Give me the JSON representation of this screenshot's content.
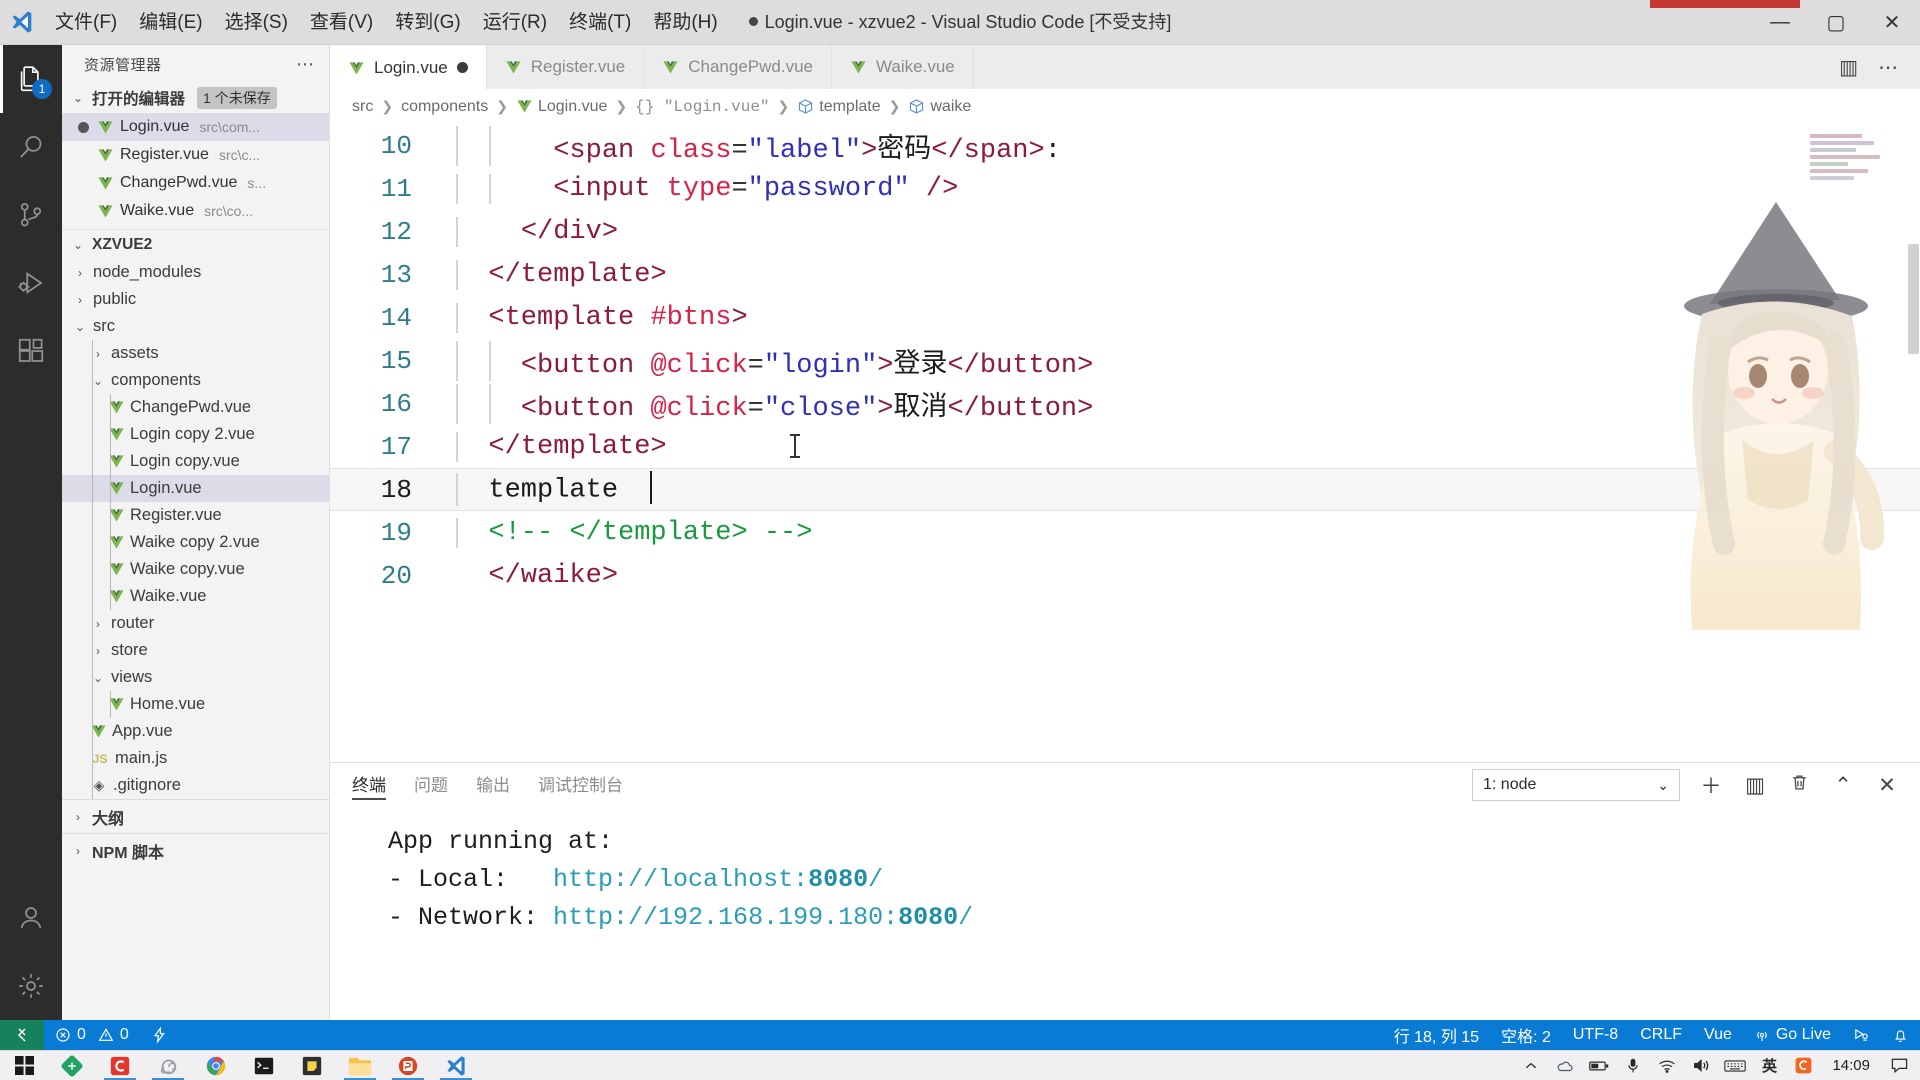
{
  "titlebar": {
    "menus": [
      "文件(F)",
      "编辑(E)",
      "选择(S)",
      "查看(V)",
      "转到(G)",
      "运行(R)",
      "终端(T)",
      "帮助(H)"
    ],
    "window_title": "Login.vue - xzvue2 - Visual Studio Code [不受支持]",
    "minimize": "—",
    "maximize": "▢",
    "close": "✕"
  },
  "activitybar": {
    "items": [
      {
        "name": "explorer",
        "icon": "files-icon",
        "badge": "1",
        "active": true
      },
      {
        "name": "search",
        "icon": "search-icon",
        "badge": "",
        "active": false
      },
      {
        "name": "source-control",
        "icon": "source-control-icon",
        "badge": "",
        "active": false
      },
      {
        "name": "run-and-debug",
        "icon": "run-debug-icon",
        "badge": "",
        "active": false
      },
      {
        "name": "extensions",
        "icon": "extensions-icon",
        "badge": "",
        "active": false
      }
    ],
    "bottom": [
      {
        "name": "accounts",
        "icon": "account-icon"
      },
      {
        "name": "settings",
        "icon": "gear-icon"
      }
    ]
  },
  "sidebar": {
    "title": "资源管理器",
    "more_actions": "⋯",
    "open_editors": {
      "label": "打开的编辑器",
      "badge": "1 个未保存",
      "chevron": "⌄",
      "items": [
        {
          "name": "Login.vue",
          "path": "src\\com...",
          "dirty": true,
          "selected": true
        },
        {
          "name": "Register.vue",
          "path": "src\\c...",
          "dirty": false,
          "selected": false
        },
        {
          "name": "ChangePwd.vue",
          "path": "s...",
          "dirty": false,
          "selected": false
        },
        {
          "name": "Waike.vue",
          "path": "src\\co...",
          "dirty": false,
          "selected": false
        }
      ]
    },
    "project": {
      "label": "XZVUE2",
      "chevron": "⌄",
      "tree": [
        {
          "label": "node_modules",
          "kind": "folder",
          "expanded": false,
          "depth": 1
        },
        {
          "label": "public",
          "kind": "folder",
          "expanded": false,
          "depth": 1
        },
        {
          "label": "src",
          "kind": "folder",
          "expanded": true,
          "depth": 1
        },
        {
          "label": "assets",
          "kind": "folder",
          "expanded": false,
          "depth": 2
        },
        {
          "label": "components",
          "kind": "folder",
          "expanded": true,
          "depth": 2
        },
        {
          "label": "ChangePwd.vue",
          "kind": "vue",
          "depth": 3
        },
        {
          "label": "Login copy 2.vue",
          "kind": "vue",
          "depth": 3
        },
        {
          "label": "Login copy.vue",
          "kind": "vue",
          "depth": 3
        },
        {
          "label": "Login.vue",
          "kind": "vue",
          "depth": 3,
          "selected": true
        },
        {
          "label": "Register.vue",
          "kind": "vue",
          "depth": 3
        },
        {
          "label": "Waike copy 2.vue",
          "kind": "vue",
          "depth": 3
        },
        {
          "label": "Waike copy.vue",
          "kind": "vue",
          "depth": 3
        },
        {
          "label": "Waike.vue",
          "kind": "vue",
          "depth": 3
        },
        {
          "label": "router",
          "kind": "folder",
          "expanded": false,
          "depth": 2
        },
        {
          "label": "store",
          "kind": "folder",
          "expanded": false,
          "depth": 2
        },
        {
          "label": "views",
          "kind": "folder",
          "expanded": true,
          "depth": 2
        },
        {
          "label": "Home.vue",
          "kind": "vue",
          "depth": 3
        },
        {
          "label": "App.vue",
          "kind": "vue",
          "depth": 2
        },
        {
          "label": "main.js",
          "kind": "js",
          "depth": 2
        },
        {
          "label": ".gitignore",
          "kind": "git",
          "depth": 2
        }
      ]
    },
    "sections": [
      {
        "label": "大纲",
        "chevron": "›"
      },
      {
        "label": "NPM 脚本",
        "chevron": "›"
      }
    ]
  },
  "editor": {
    "tabs": [
      {
        "label": "Login.vue",
        "active": true,
        "dirty": true
      },
      {
        "label": "Register.vue",
        "active": false,
        "dirty": false
      },
      {
        "label": "ChangePwd.vue",
        "active": false,
        "dirty": false
      },
      {
        "label": "Waike.vue",
        "active": false,
        "dirty": false
      }
    ],
    "tab_actions": [
      {
        "name": "split-editor-icon",
        "glyph": "▥"
      },
      {
        "name": "more-actions-icon",
        "glyph": "⋯"
      }
    ],
    "breadcrumb": [
      "src",
      "components",
      "Login.vue",
      "{} \"Login.vue\"",
      "template",
      "waike"
    ],
    "lines": [
      {
        "num": "10",
        "indent_guides": 2,
        "tokens": [
          {
            "t": "      ",
            "c": "plain"
          },
          {
            "t": "<span ",
            "c": "tag"
          },
          {
            "t": "class",
            "c": "attr"
          },
          {
            "t": "=",
            "c": "eq"
          },
          {
            "t": "\"label\"",
            "c": "str"
          },
          {
            "t": ">",
            "c": "tag"
          },
          {
            "t": "密码",
            "c": "text"
          },
          {
            "t": "</span>",
            "c": "tag"
          },
          {
            "t": ":",
            "c": "text"
          }
        ]
      },
      {
        "num": "11",
        "indent_guides": 2,
        "tokens": [
          {
            "t": "      ",
            "c": "plain"
          },
          {
            "t": "<input ",
            "c": "tag"
          },
          {
            "t": "type",
            "c": "attr"
          },
          {
            "t": "=",
            "c": "eq"
          },
          {
            "t": "\"password\"",
            "c": "str"
          },
          {
            "t": " />",
            "c": "tag"
          }
        ]
      },
      {
        "num": "12",
        "indent_guides": 1,
        "tokens": [
          {
            "t": "    ",
            "c": "plain"
          },
          {
            "t": "</div>",
            "c": "tag"
          }
        ]
      },
      {
        "num": "13",
        "indent_guides": 1,
        "tokens": [
          {
            "t": "  ",
            "c": "plain"
          },
          {
            "t": "</template>",
            "c": "tag"
          }
        ]
      },
      {
        "num": "14",
        "indent_guides": 1,
        "tokens": [
          {
            "t": "  ",
            "c": "plain"
          },
          {
            "t": "<template ",
            "c": "tag"
          },
          {
            "t": "#btns",
            "c": "attr"
          },
          {
            "t": ">",
            "c": "tag"
          }
        ]
      },
      {
        "num": "15",
        "indent_guides": 2,
        "tokens": [
          {
            "t": "    ",
            "c": "plain"
          },
          {
            "t": "<button ",
            "c": "tag"
          },
          {
            "t": "@click",
            "c": "attr"
          },
          {
            "t": "=",
            "c": "eq"
          },
          {
            "t": "\"login\"",
            "c": "str"
          },
          {
            "t": ">",
            "c": "tag"
          },
          {
            "t": "登录",
            "c": "text"
          },
          {
            "t": "</button>",
            "c": "tag"
          }
        ]
      },
      {
        "num": "16",
        "indent_guides": 2,
        "tokens": [
          {
            "t": "    ",
            "c": "plain"
          },
          {
            "t": "<button ",
            "c": "tag"
          },
          {
            "t": "@click",
            "c": "attr"
          },
          {
            "t": "=",
            "c": "eq"
          },
          {
            "t": "\"close\"",
            "c": "str"
          },
          {
            "t": ">",
            "c": "tag"
          },
          {
            "t": "取消",
            "c": "text"
          },
          {
            "t": "</button>",
            "c": "tag"
          }
        ]
      },
      {
        "num": "17",
        "indent_guides": 1,
        "tokens": [
          {
            "t": "  ",
            "c": "plain"
          },
          {
            "t": "</template>",
            "c": "tag"
          }
        ]
      },
      {
        "num": "18",
        "indent_guides": 1,
        "current": true,
        "caret_after": true,
        "tokens": [
          {
            "t": "  ",
            "c": "plain"
          },
          {
            "t": "template  ",
            "c": "text"
          }
        ]
      },
      {
        "num": "19",
        "indent_guides": 1,
        "tokens": [
          {
            "t": "  ",
            "c": "plain"
          },
          {
            "t": "<!-- </template> -->",
            "c": "comment"
          }
        ]
      },
      {
        "num": "20",
        "indent_guides": 0,
        "tokens": [
          {
            "t": "  ",
            "c": "plain"
          },
          {
            "t": "</waike>",
            "c": "tag"
          }
        ]
      }
    ]
  },
  "panel": {
    "tabs": [
      {
        "label": "终端",
        "active": true
      },
      {
        "label": "问题",
        "active": false
      },
      {
        "label": "输出",
        "active": false
      },
      {
        "label": "调试控制台",
        "active": false
      }
    ],
    "terminal_select": {
      "value": "1: node",
      "chevron": "⌄"
    },
    "actions": [
      {
        "name": "new-terminal-icon",
        "glyph": "＋"
      },
      {
        "name": "split-terminal-icon",
        "glyph": "▥"
      },
      {
        "name": "kill-terminal-icon",
        "glyph": "🗑"
      },
      {
        "name": "maximize-panel-icon",
        "glyph": "⌃"
      },
      {
        "name": "close-panel-icon",
        "glyph": "✕"
      }
    ],
    "terminal_lines": [
      {
        "text": "App running at:",
        "url": "",
        "port": ""
      },
      {
        "prefix": "- Local:   ",
        "url": "http://localhost:",
        "port": "8080",
        "suffix": "/"
      },
      {
        "prefix": "- Network: ",
        "url": "http://192.168.199.180:",
        "port": "8080",
        "suffix": "/"
      }
    ]
  },
  "statusbar": {
    "remote_icon": "remote-window-icon",
    "errors": "0",
    "warnings": "0",
    "ports_icon": "ports-icon",
    "right_items": [
      {
        "name": "cursor-position",
        "label": "行 18, 列 15"
      },
      {
        "name": "indentation",
        "label": "空格: 2"
      },
      {
        "name": "encoding",
        "label": "UTF-8"
      },
      {
        "name": "eol",
        "label": "CRLF"
      },
      {
        "name": "language-mode",
        "label": "Vue"
      },
      {
        "name": "go-live",
        "label": "Go Live"
      },
      {
        "name": "feedback",
        "label": ""
      },
      {
        "name": "notifications",
        "label": ""
      }
    ]
  },
  "taskbar": {
    "items": [
      {
        "name": "start-button",
        "icon": "windows-icon",
        "running": false
      },
      {
        "name": "taskbar-wechat-dev",
        "icon": "green-diamond-icon",
        "running": false
      },
      {
        "name": "taskbar-app-c",
        "icon": "red-c-icon",
        "running": true
      },
      {
        "name": "taskbar-app-snail",
        "icon": "snail-icon",
        "running": true
      },
      {
        "name": "taskbar-chrome",
        "icon": "chrome-icon",
        "running": false
      },
      {
        "name": "taskbar-terminal",
        "icon": "console-icon",
        "running": false
      },
      {
        "name": "taskbar-notepad",
        "icon": "notes-icon",
        "running": false
      },
      {
        "name": "taskbar-explorer",
        "icon": "folder-icon",
        "running": true
      },
      {
        "name": "taskbar-powerpoint",
        "icon": "powerpoint-icon",
        "running": true
      },
      {
        "name": "taskbar-vscode",
        "icon": "vscode-icon",
        "running": true
      }
    ],
    "tray": [
      {
        "name": "show-hidden-icons",
        "glyph": "⌃"
      },
      {
        "name": "onedrive-icon",
        "glyph": "☁"
      },
      {
        "name": "battery-icon",
        "glyph": "▭"
      },
      {
        "name": "microphone-icon",
        "glyph": "🎤"
      },
      {
        "name": "wifi-icon",
        "glyph": "📶"
      },
      {
        "name": "volume-icon",
        "glyph": "🔊"
      },
      {
        "name": "keyboard-icon",
        "glyph": "⌨"
      },
      {
        "name": "ime-english-icon",
        "glyph": "英"
      },
      {
        "name": "sogou-input-icon",
        "glyph": "S"
      }
    ],
    "clock": "14:09",
    "action_center": "action-center-icon"
  }
}
